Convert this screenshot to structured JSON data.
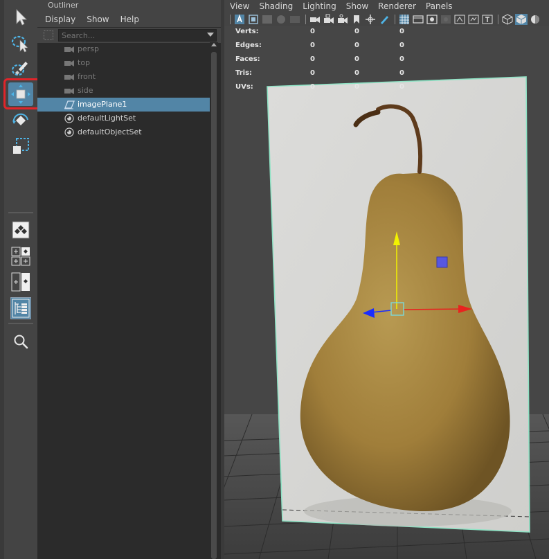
{
  "outliner": {
    "title": "Outliner",
    "menu": [
      "Display",
      "Show",
      "Help"
    ],
    "search_placeholder": "Search...",
    "items": [
      {
        "label": "persp",
        "icon": "camera-icon"
      },
      {
        "label": "top",
        "icon": "camera-icon"
      },
      {
        "label": "front",
        "icon": "camera-icon"
      },
      {
        "label": "side",
        "icon": "camera-icon"
      },
      {
        "label": "imagePlane1",
        "icon": "image-plane-icon",
        "selected": true
      },
      {
        "label": "defaultLightSet",
        "icon": "set-icon"
      },
      {
        "label": "defaultObjectSet",
        "icon": "set-icon"
      }
    ]
  },
  "viewport": {
    "menu": [
      "View",
      "Shading",
      "Lighting",
      "Show",
      "Renderer",
      "Panels"
    ],
    "hud": [
      {
        "label": "Verts:",
        "values": [
          "0",
          "0",
          "0"
        ]
      },
      {
        "label": "Edges:",
        "values": [
          "0",
          "0",
          "0"
        ]
      },
      {
        "label": "Faces:",
        "values": [
          "0",
          "0",
          "0"
        ]
      },
      {
        "label": "Tris:",
        "values": [
          "0",
          "0",
          "0"
        ]
      },
      {
        "label": "UVs:",
        "values": [
          "0",
          "0",
          "0"
        ]
      }
    ]
  },
  "toolbox": {
    "tools": [
      "select-tool-icon",
      "lasso-tool-icon",
      "paint-select-tool-icon",
      "move-tool-icon",
      "rotate-tool-icon",
      "scale-tool-icon"
    ],
    "active_tool": "move-tool-icon",
    "layouts": [
      "single-pane-layout-icon",
      "four-pane-layout-icon",
      "two-pane-layout-icon",
      "outliner-layout-icon"
    ],
    "active_layout": "outliner-layout-icon"
  },
  "colors": {
    "selection": "#5285a6",
    "highlight_frame": "#e0252a",
    "move_x": "#e8231f",
    "move_y": "#f2f200",
    "move_z": "#1a2cff",
    "image_plane_border": "#8fe3c5"
  }
}
